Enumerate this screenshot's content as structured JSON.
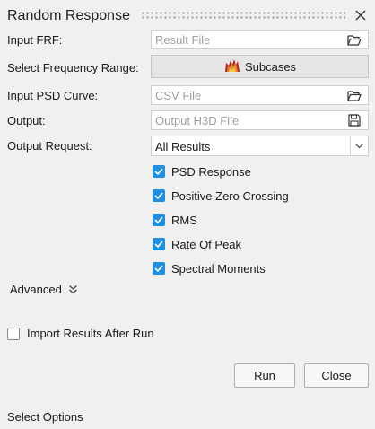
{
  "window": {
    "title": "Random Response",
    "close_icon": "close-icon"
  },
  "form": {
    "input_frf": {
      "label": "Input FRF:",
      "value": "",
      "placeholder": "Result File",
      "icon": "folder-open-icon"
    },
    "frequency_range": {
      "label": "Select Frequency Range:",
      "button_label": "Subcases",
      "icon": "subcases-icon"
    },
    "input_psd": {
      "label": "Input PSD Curve:",
      "value": "",
      "placeholder": "CSV File",
      "icon": "folder-open-icon"
    },
    "output": {
      "label": "Output:",
      "value": "",
      "placeholder": "Output H3D File",
      "icon": "save-icon"
    },
    "output_request": {
      "label": "Output Request:",
      "selected": "All Results",
      "icon": "chevron-down-icon"
    },
    "checkboxes": [
      {
        "label": "PSD Response",
        "checked": true
      },
      {
        "label": "Positive Zero Crossing",
        "checked": true
      },
      {
        "label": "RMS",
        "checked": true
      },
      {
        "label": "Rate Of Peak",
        "checked": true
      },
      {
        "label": "Spectral Moments",
        "checked": true
      }
    ]
  },
  "advanced": {
    "label": "Advanced",
    "icon": "double-chevron-down-icon"
  },
  "import_results": {
    "label": "Import Results After Run",
    "checked": false
  },
  "buttons": {
    "run": "Run",
    "close": "Close"
  },
  "status_bar": {
    "text": "Select Options"
  },
  "colors": {
    "background": "#f0f0f0",
    "checkbox_accent": "#1f8fe0",
    "field_border": "#cfcfcf"
  }
}
